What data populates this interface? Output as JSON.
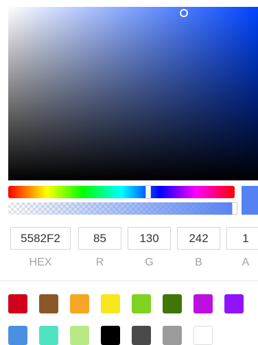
{
  "picker": {
    "hue_color": "#0044ff",
    "current_color": "#5582F2",
    "hue_position": 0.62,
    "alpha_value": 1
  },
  "fields": {
    "hex": {
      "value": "5582F2",
      "label": "HEX"
    },
    "r": {
      "value": "85",
      "label": "R"
    },
    "g": {
      "value": "130",
      "label": "G"
    },
    "b": {
      "value": "242",
      "label": "B"
    },
    "a": {
      "value": "1",
      "label": "A"
    }
  },
  "presets": [
    "#D0021B",
    "#8B572A",
    "#F5A623",
    "#F8E71C",
    "#7ED321",
    "#417505",
    "#BD10E0",
    "#9013FE",
    "#4A90E2",
    "#50E3C2",
    "#B8E986",
    "#000000",
    "#4A4A4A",
    "#9B9B9B",
    "#FFFFFF"
  ]
}
